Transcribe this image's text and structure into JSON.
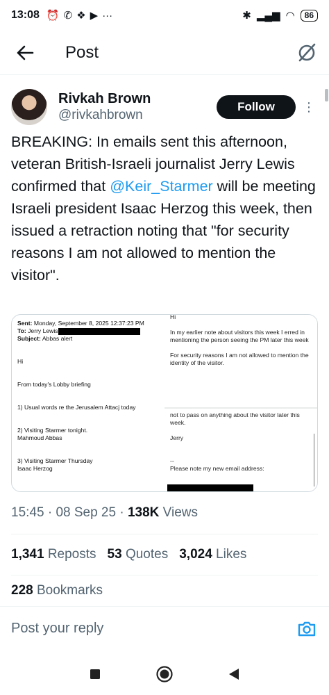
{
  "status_bar": {
    "time": "13:08",
    "left_icons": [
      "alarm-icon",
      "whatsapp-icon",
      "dropbox-icon",
      "youtube-icon"
    ],
    "overflow": "···",
    "battery": "86"
  },
  "header": {
    "title": "Post"
  },
  "author": {
    "name": "Rivkah Brown",
    "handle": "@rivkahbrown",
    "follow_label": "Follow"
  },
  "tweet": {
    "text_before": "BREAKING: In emails sent this afternoon, veteran British-Israeli journalist Jerry Lewis confirmed that ",
    "mention": "@Keir_Starmer",
    "text_after": " will be meeting Israeli president Isaac Herzog this week, then issued a retraction noting that \"for security reasons I am not allowed to mention the visitor\"."
  },
  "email_image": {
    "sent_label": "Sent:",
    "sent_value": "Monday, September 8, 2025 12:37:23 PM",
    "to_label": "To:",
    "to_value": "Jerry Lewis",
    "subject_label": "Subject:",
    "subject_value": "Abbas alert",
    "left_lines": [
      "Hi",
      "From today's Lobby briefing",
      "1) Usual words re the Jerusalem Attacj today",
      "2) Visiting Starmer tonight.",
      "Mahmoud Abbas",
      "3) Visiting Starmer Thursday",
      "Isaac Herzog"
    ],
    "right_top": [
      "Hi",
      "In my earlier note about visitors this week I erred in mentioning the person seeing the PM later this week",
      "For security reasons I am not allowed to mention the identity of the visitor."
    ],
    "right_bottom": [
      "not to pass on anything about the visitor later this week.",
      "Jerry",
      "--",
      "Please note my new email address:"
    ]
  },
  "meta": {
    "time": "15:45",
    "date": "08 Sep 25",
    "views_count": "138K",
    "views_label": "Views"
  },
  "stats": {
    "reposts_count": "1,341",
    "reposts_label": "Reposts",
    "quotes_count": "53",
    "quotes_label": "Quotes",
    "likes_count": "3,024",
    "likes_label": "Likes",
    "bookmarks_count": "228",
    "bookmarks_label": "Bookmarks"
  },
  "reply": {
    "placeholder": "Post your reply"
  },
  "colors": {
    "accent": "#1d9bf0",
    "text": "#0f1419",
    "secondary": "#536471",
    "border": "#eff3f4"
  }
}
